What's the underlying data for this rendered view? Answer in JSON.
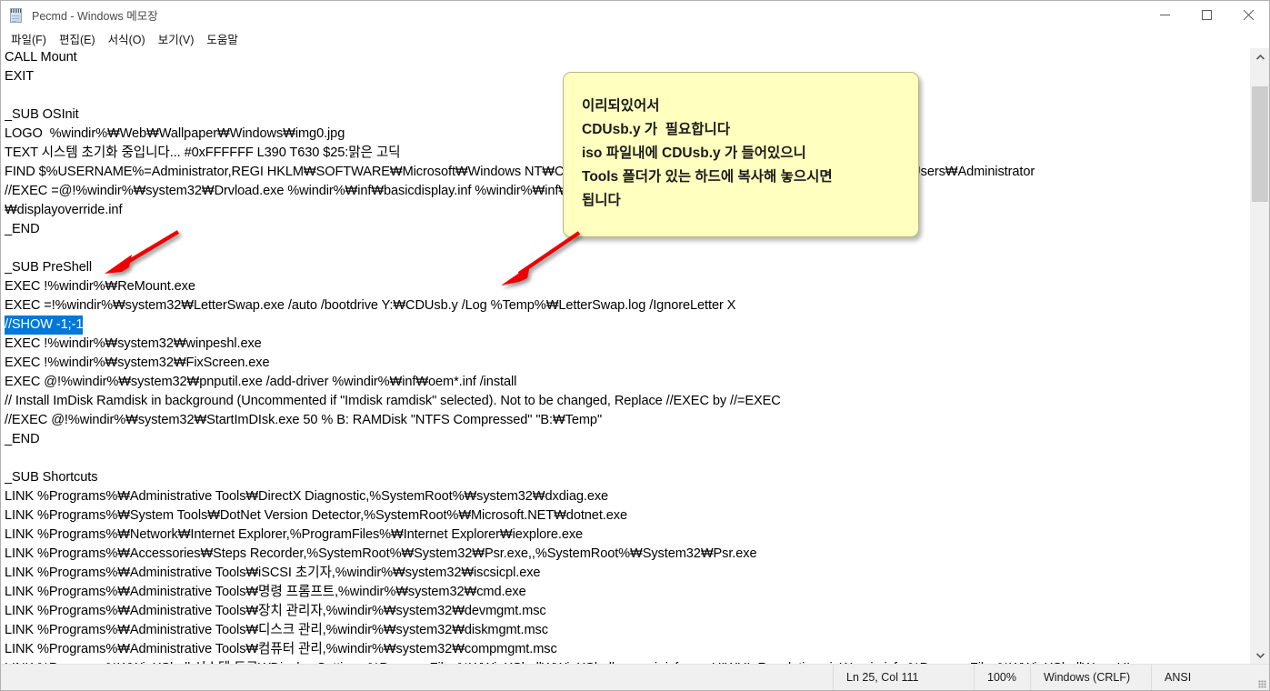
{
  "window": {
    "title": "Pecmd - Windows 메모장",
    "icon": "notepad-icon",
    "minimize_label": "최소화",
    "maximize_label": "최대화",
    "close_label": "닫기"
  },
  "menu": {
    "items": [
      {
        "label": "파일(F)",
        "name": "file"
      },
      {
        "label": "편집(E)",
        "name": "edit"
      },
      {
        "label": "서식(O)",
        "name": "format"
      },
      {
        "label": "보기(V)",
        "name": "view"
      },
      {
        "label": "도움말",
        "name": "help"
      }
    ]
  },
  "editor": {
    "selected_line_index": 14,
    "selection_color": "#0078D7",
    "lines": [
      "CALL Mount",
      "EXIT",
      "",
      "_SUB OSInit",
      "LOGO  %windir%\\Web\\Wallpaper\\Windows\\img0.jpg",
      "TEXT 시스템 초기화 중입니다... #0xFFFFFF L390 T630 $25:맑은 고딕",
      "FIND $%USERNAME%=Administrator,REGI HKLM\\SOFTWARE\\Microsoft\\Windows NT\\CurrentVersion\\ProfileList\\S-1-5-21,ProfileImagePath=X:\\Users\\Administrator",
      "//EXEC =@!%windir%\\system32\\Drvload.exe %windir%\\inf\\basicdisplay.inf %windir%\\inf\\basicrender.inf %windir%\\inf\\display.inf %windir%\\inf",
      "\\displayoverride.inf",
      "_END",
      "",
      "_SUB PreShell",
      "EXEC !%windir%\\ReMount.exe",
      "EXEC =!%windir%\\system32\\LetterSwap.exe /auto /bootdrive Y:\\CDUsb.y /Log %Temp%\\LetterSwap.log /IgnoreLetter X",
      "//SHOW -1;-1",
      "EXEC !%windir%\\system32\\winpeshl.exe",
      "EXEC !%windir%\\system32\\FixScreen.exe",
      "EXEC @!%windir%\\system32\\pnputil.exe /add-driver %windir%\\inf\\oem*.inf /install",
      "// Install ImDisk Ramdisk in background (Uncommented if \"Imdisk ramdisk\" selected). Not to be changed, Replace //EXEC by //=EXEC",
      "//EXEC @!%windir%\\system32\\StartImDIsk.exe 50 % B: RAMDisk \"NTFS Compressed\" \"B:\\Temp\"",
      "_END",
      "",
      "_SUB Shortcuts",
      "LINK %Programs%\\Administrative Tools\\DirectX Diagnostic,%SystemRoot%\\system32\\dxdiag.exe",
      "LINK %Programs%\\System Tools\\DotNet Version Detector,%SystemRoot%\\Microsoft.NET\\dotnet.exe",
      "LINK %Programs%\\Network\\Internet Explorer,%ProgramFiles%\\Internet Explorer\\iexplore.exe",
      "LINK %Programs%\\Accessories\\Steps Recorder,%SystemRoot%\\System32\\Psr.exe,,%SystemRoot%\\System32\\Psr.exe",
      "LINK %Programs%\\Administrative Tools\\iSCSI 초기자,%windir%\\system32\\iscsicpl.exe",
      "LINK %Programs%\\Administrative Tools\\명령 프롬프트,%windir%\\system32\\cmd.exe",
      "LINK %Programs%\\Administrative Tools\\장치 관리자,%windir%\\system32\\devmgmt.msc",
      "LINK %Programs%\\Administrative Tools\\디스크 관리,%windir%\\system32\\diskmgmt.msc",
      "LINK %Programs%\\Administrative Tools\\컴퓨터 관리,%windir%\\system32\\compmgmt.msc",
      "LINK %Programs%\\WinXShell 시스템 도구\\Display Settings,%ProgramFiles%\\WinXShell\\WinXShell.exe -ui -icfg wxsUI\\UI_Resolution.zip\\main.icfg %ProgramFiles%\\WinXShell\\wxsUI"
    ]
  },
  "callout": {
    "background": "#FFFFBF",
    "border": "#B9B97A",
    "lines": [
      "이리되있어서",
      "CDUsb.y 가  필요합니다",
      "iso 파일내에 CDUsb.y 가 들어있으니",
      "Tools 폴더가 있는 하드에 복사해 놓으시면",
      "됩니다"
    ]
  },
  "annotations": {
    "arrow_color": "#EE0000",
    "arrows": [
      {
        "name": "arrow-to-preshell",
        "target": "_SUB PreShell"
      },
      {
        "name": "arrow-to-letterswap-line",
        "target": "EXEC LetterSwap line"
      }
    ]
  },
  "statusbar": {
    "position": "Ln 25, Col 111",
    "zoom": "100%",
    "line_ending": "Windows (CRLF)",
    "encoding": "ANSI"
  },
  "scrollbar": {
    "up_arrow": "chevron-up-icon",
    "down_arrow": "chevron-down-icon"
  }
}
